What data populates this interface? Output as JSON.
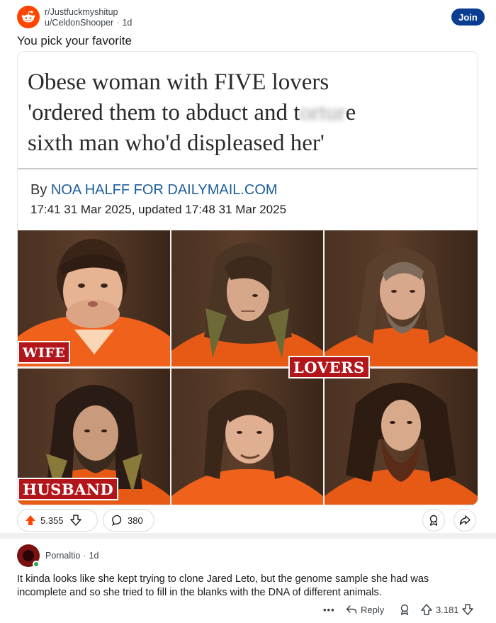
{
  "post": {
    "subreddit": "r/Justfuckmyshitup",
    "author": "u/CeldonShooper",
    "age": "1d",
    "join_label": "Join",
    "title": "You pick your favorite"
  },
  "article": {
    "headline_line1": "Obese woman with FIVE lovers",
    "headline_line2_a": "'ordered them to abduct and t",
    "headline_line2_blur": "ortur",
    "headline_line2_b": "e",
    "headline_line3": "sixth man who'd displeased her'",
    "byline_by": "By",
    "byline_author": "NOA HALFF FOR DAILYMAIL.COM",
    "dateline": "17:41 31 Mar 2025, updated 17:48 31 Mar 2025",
    "labels": {
      "wife": "WIFE",
      "lovers": "LOVERS",
      "husband": "HUSBAND"
    }
  },
  "actions": {
    "upvotes": "5.355",
    "comments": "380"
  },
  "comment": {
    "author": "Pornaltio",
    "age": "1d",
    "body": "It kinda looks like she kept trying to clone Jared Leto, but the genome sample she had was incomplete and so she tried to fill in the blanks with the DNA of different animals.",
    "more": "•••",
    "reply_label": "Reply",
    "upvotes": "3.181"
  },
  "colors": {
    "upvote_accent": "#ff4500",
    "join_button": "#0a3d91",
    "label_red": "#b3151b",
    "author_link": "#1c5d9a",
    "online": "#2fa84f"
  },
  "icons": [
    "reddit-snoo-icon",
    "upvote-icon",
    "downvote-icon",
    "comment-icon",
    "award-icon",
    "share-icon",
    "reply-icon",
    "more-icon"
  ]
}
